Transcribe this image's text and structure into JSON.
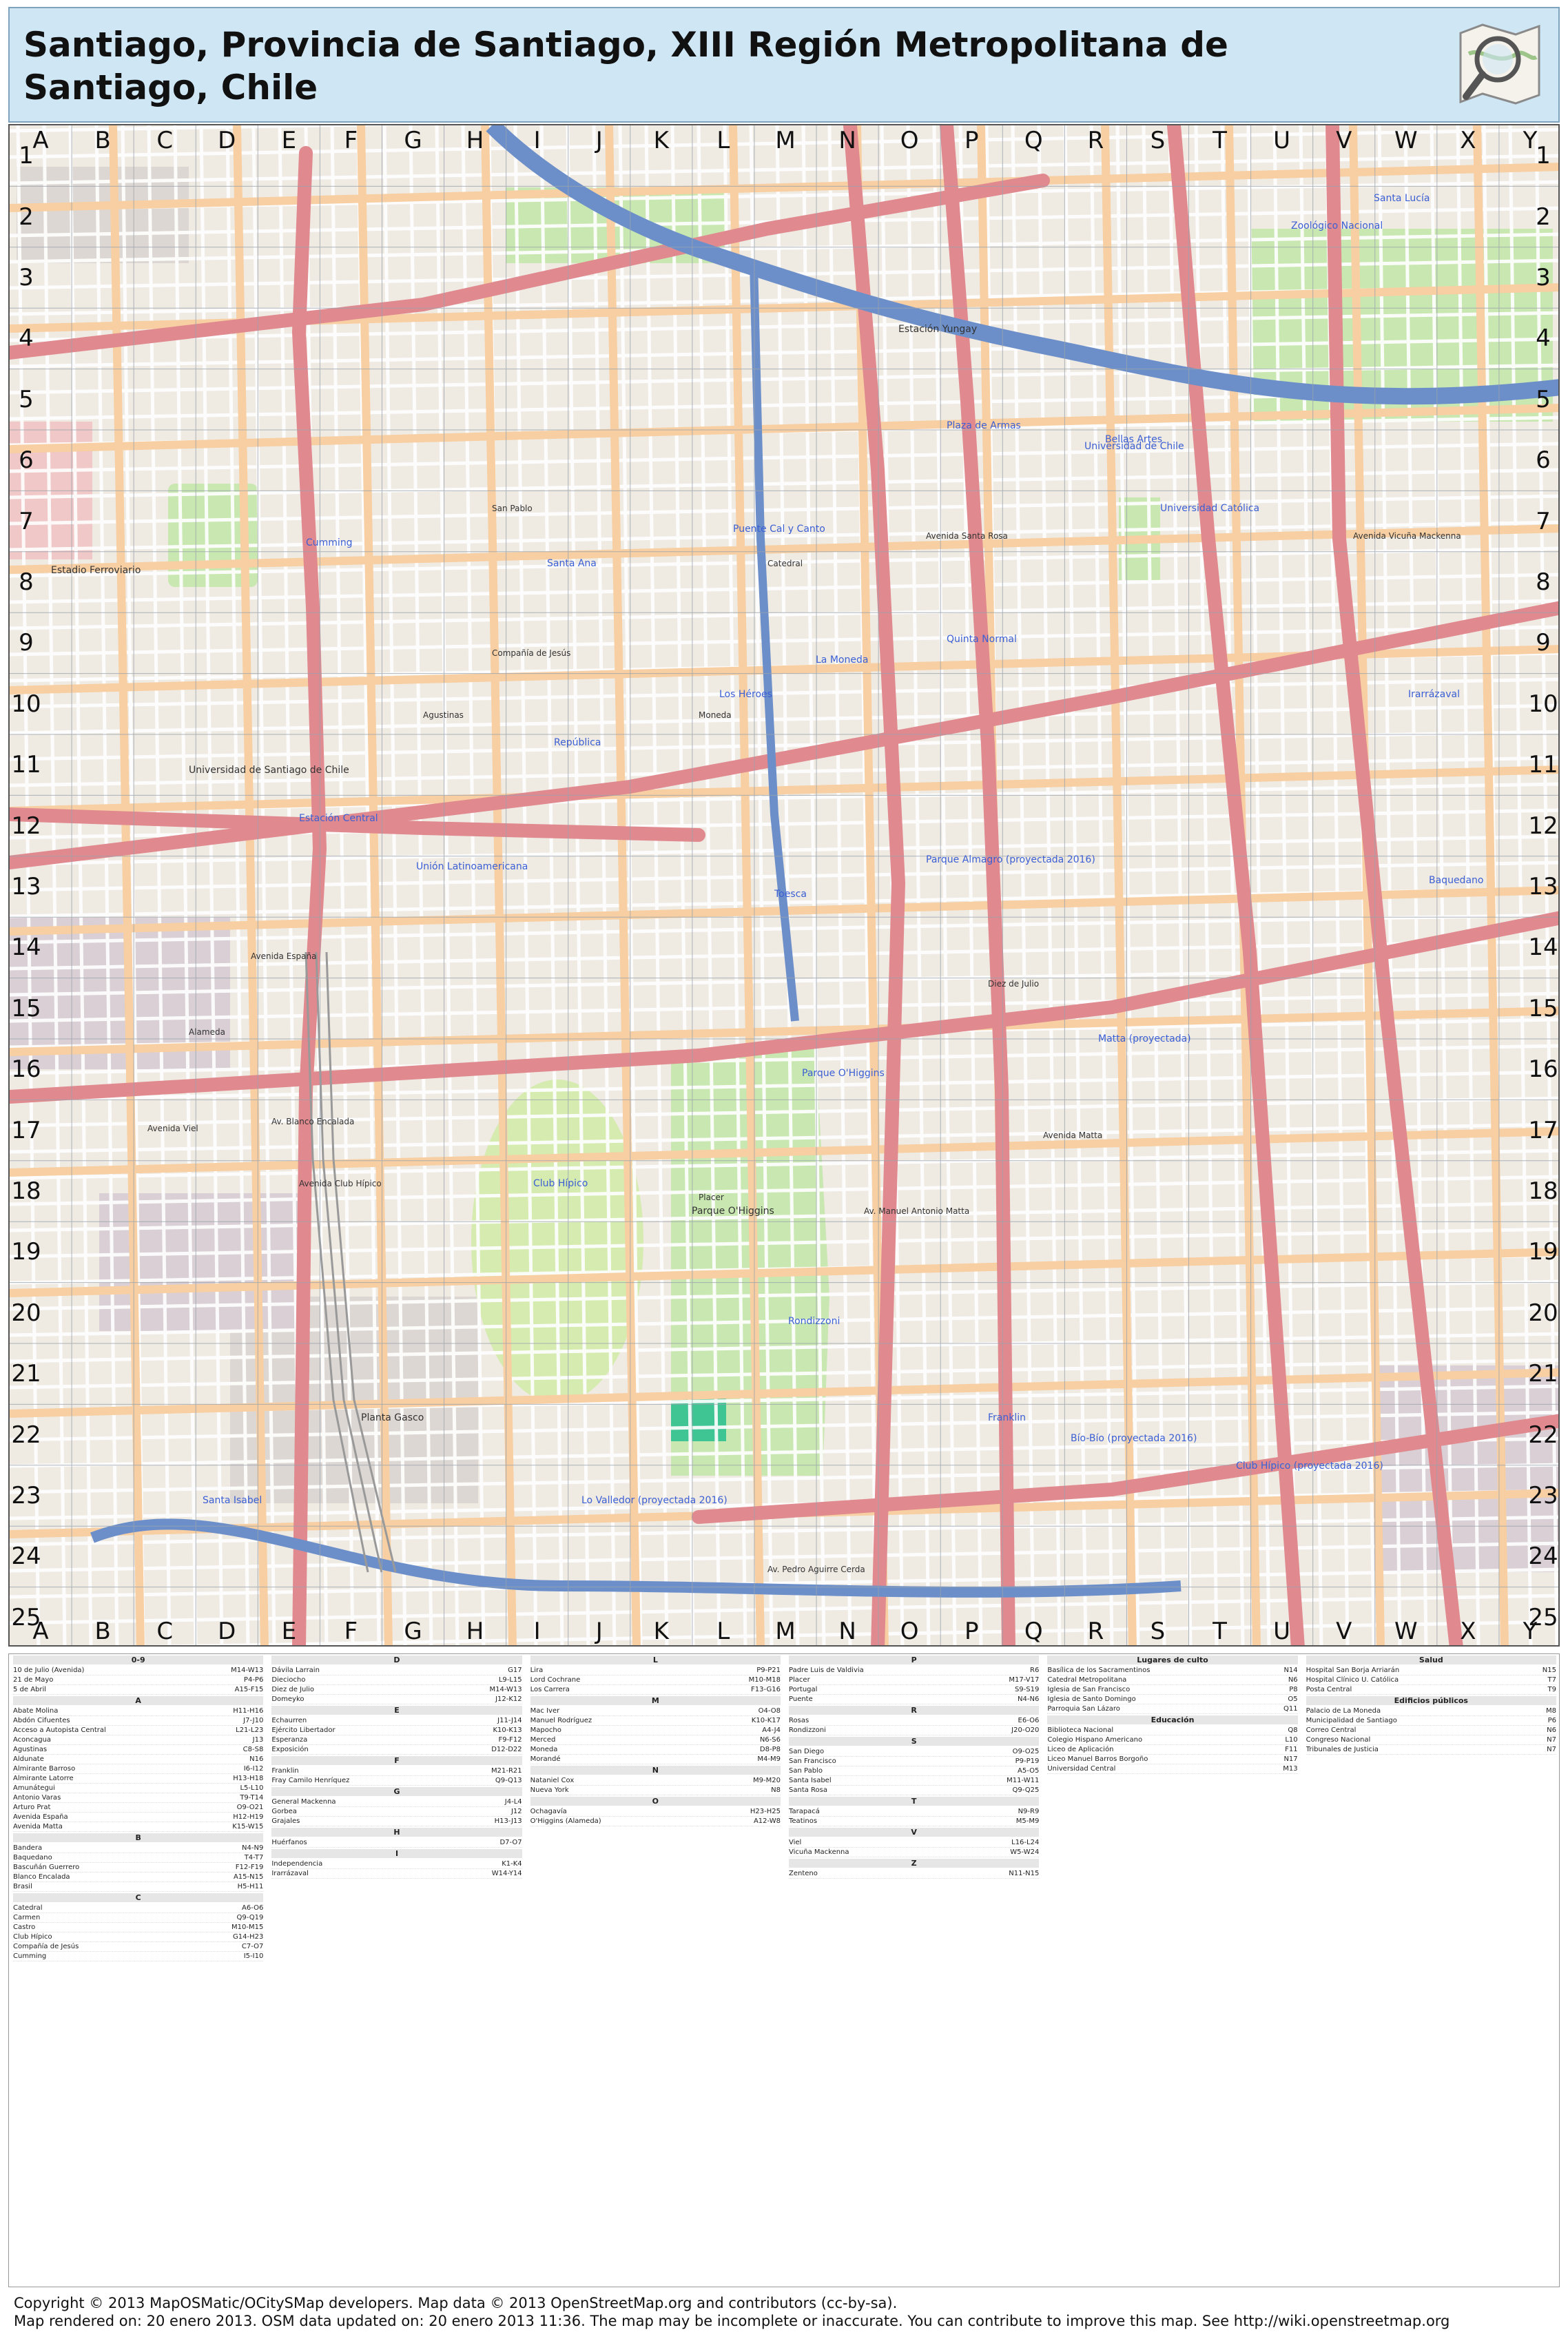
{
  "header": {
    "title": "Santiago, Provincia de Santiago, XIII Región Metropolitana de Santiago, Chile"
  },
  "grid": {
    "columns": [
      "A",
      "B",
      "C",
      "D",
      "E",
      "F",
      "G",
      "H",
      "I",
      "J",
      "K",
      "L",
      "M",
      "N",
      "O",
      "P",
      "Q",
      "R",
      "S",
      "T",
      "U",
      "V",
      "W",
      "X",
      "Y"
    ],
    "rows": [
      "1",
      "2",
      "3",
      "4",
      "5",
      "6",
      "7",
      "8",
      "9",
      "10",
      "11",
      "12",
      "13",
      "14",
      "15",
      "16",
      "17",
      "18",
      "19",
      "20",
      "21",
      "22",
      "23",
      "24",
      "25"
    ]
  },
  "map_labels": {
    "landmarks": [
      {
        "name": "Club Hípico",
        "color": "#3b5fd4"
      },
      {
        "name": "Parque O'Higgins",
        "color": "#333333"
      },
      {
        "name": "Universidad de Santiago de Chile",
        "color": "#333333"
      },
      {
        "name": "Zoológico Nacional",
        "color": "#3b5fd4"
      },
      {
        "name": "Plaza de Armas",
        "color": "#3b5fd4"
      },
      {
        "name": "Bellas Artes",
        "color": "#3b5fd4"
      },
      {
        "name": "Universidad Católica",
        "color": "#3b5fd4"
      },
      {
        "name": "Estación Central",
        "color": "#3b5fd4"
      },
      {
        "name": "Unión Latinoamericana",
        "color": "#3b5fd4"
      },
      {
        "name": "República",
        "color": "#3b5fd4"
      },
      {
        "name": "Los Héroes",
        "color": "#3b5fd4"
      },
      {
        "name": "La Moneda",
        "color": "#3b5fd4"
      },
      {
        "name": "Toesca",
        "color": "#3b5fd4"
      },
      {
        "name": "Parque Almagro (proyectada 2016)",
        "color": "#3b5fd4"
      },
      {
        "name": "Matta (proyectada)",
        "color": "#3b5fd4"
      },
      {
        "name": "Parque O'Higgins",
        "color": "#3b5fd4"
      },
      {
        "name": "Rondizzoni",
        "color": "#3b5fd4"
      },
      {
        "name": "Franklin",
        "color": "#3b5fd4"
      },
      {
        "name": "Bío-Bío (proyectada 2016)",
        "color": "#3b5fd4"
      },
      {
        "name": "Club Hípico (proyectada 2016)",
        "color": "#3b5fd4"
      },
      {
        "name": "Lo Valledor (proyectada 2016)",
        "color": "#3b5fd4"
      },
      {
        "name": "Santa Isabel",
        "color": "#3b5fd4"
      },
      {
        "name": "Irarrázaval",
        "color": "#3b5fd4"
      },
      {
        "name": "Baquedano",
        "color": "#3b5fd4"
      },
      {
        "name": "Santa Lucía",
        "color": "#3b5fd4"
      },
      {
        "name": "Universidad de Chile",
        "color": "#3b5fd4"
      },
      {
        "name": "Quinta Normal",
        "color": "#3b5fd4"
      },
      {
        "name": "Cumming",
        "color": "#3b5fd4"
      },
      {
        "name": "Santa Ana",
        "color": "#3b5fd4"
      },
      {
        "name": "Puente Cal y Canto",
        "color": "#3b5fd4"
      },
      {
        "name": "Estación Yungay",
        "color": "#333333"
      },
      {
        "name": "Estadio Ferroviario",
        "color": "#333333"
      },
      {
        "name": "Planta Gasco",
        "color": "#333333"
      }
    ],
    "streets": [
      "Avenida Santa Rosa",
      "Avenida Matta",
      "San Pablo",
      "Catedral",
      "Compañía de Jesús",
      "Agustinas",
      "Moneda",
      "Alameda",
      "Avenida Viel",
      "Avenida Club Hípico",
      "Diez de Julio",
      "Av. Blanco Encalada",
      "Av. Manuel Antonio Matta",
      "Placer",
      "Avenida España",
      "Avenida Vicuña Mackenna",
      "Av. Pedro Aguirre Cerda"
    ]
  },
  "index": {
    "columns": [
      {
        "sections": [
          {
            "head": "0-9",
            "items": [
              [
                "10 de Julio (Avenida)",
                "M14-W13"
              ],
              [
                "21 de Mayo",
                "P4-P6"
              ],
              [
                "5 de Abril",
                "A15-F15"
              ]
            ]
          },
          {
            "head": "A",
            "items": [
              [
                "Abate Molina",
                "H11-H16"
              ],
              [
                "Abdón Cifuentes",
                "J7-J10"
              ],
              [
                "Acceso a Autopista Central",
                "L21-L23"
              ],
              [
                "Aconcagua",
                "J13"
              ],
              [
                "Agustinas",
                "C8-S8"
              ],
              [
                "Aldunate",
                "N16"
              ],
              [
                "Almirante Barroso",
                "I6-I12"
              ],
              [
                "Almirante Latorre",
                "H13-H18"
              ],
              [
                "Amunátegui",
                "L5-L10"
              ],
              [
                "Antonio Varas",
                "T9-T14"
              ],
              [
                "Arturo Prat",
                "O9-O21"
              ],
              [
                "Avenida España",
                "H12-H19"
              ],
              [
                "Avenida Matta",
                "K15-W15"
              ]
            ]
          },
          {
            "head": "B",
            "items": [
              [
                "Bandera",
                "N4-N9"
              ],
              [
                "Baquedano",
                "T4-T7"
              ],
              [
                "Bascuñán Guerrero",
                "F12-F19"
              ],
              [
                "Blanco Encalada",
                "A15-N15"
              ],
              [
                "Brasil",
                "H5-H11"
              ]
            ]
          },
          {
            "head": "C",
            "items": [
              [
                "Catedral",
                "A6-O6"
              ],
              [
                "Carmen",
                "Q9-Q19"
              ],
              [
                "Castro",
                "M10-M15"
              ],
              [
                "Club Hípico",
                "G14-H23"
              ],
              [
                "Compañía de Jesús",
                "C7-O7"
              ],
              [
                "Cumming",
                "I5-I10"
              ]
            ]
          }
        ]
      },
      {
        "sections": [
          {
            "head": "D",
            "items": [
              [
                "Dávila Larrain",
                "G17"
              ],
              [
                "Dieciocho",
                "L9-L15"
              ],
              [
                "Diez de Julio",
                "M14-W13"
              ],
              [
                "Domeyko",
                "J12-K12"
              ]
            ]
          },
          {
            "head": "E",
            "items": [
              [
                "Echaurren",
                "J11-J14"
              ],
              [
                "Ejército Libertador",
                "K10-K13"
              ],
              [
                "Esperanza",
                "F9-F12"
              ],
              [
                "Exposición",
                "D12-D22"
              ]
            ]
          },
          {
            "head": "F",
            "items": [
              [
                "Franklin",
                "M21-R21"
              ],
              [
                "Fray Camilo Henríquez",
                "Q9-Q13"
              ]
            ]
          },
          {
            "head": "G",
            "items": [
              [
                "General Mackenna",
                "J4-L4"
              ],
              [
                "Gorbea",
                "J12"
              ],
              [
                "Grajales",
                "H13-J13"
              ]
            ]
          },
          {
            "head": "H",
            "items": [
              [
                "Huérfanos",
                "D7-O7"
              ]
            ]
          },
          {
            "head": "I",
            "items": [
              [
                "Independencia",
                "K1-K4"
              ],
              [
                "Irarrázaval",
                "W14-Y14"
              ]
            ]
          }
        ]
      },
      {
        "sections": [
          {
            "head": "L",
            "items": [
              [
                "Lira",
                "P9-P21"
              ],
              [
                "Lord Cochrane",
                "M10-M18"
              ],
              [
                "Los Carrera",
                "F13-G16"
              ]
            ]
          },
          {
            "head": "M",
            "items": [
              [
                "Mac Iver",
                "O4-O8"
              ],
              [
                "Manuel Rodríguez",
                "K10-K17"
              ],
              [
                "Mapocho",
                "A4-J4"
              ],
              [
                "Merced",
                "N6-S6"
              ],
              [
                "Moneda",
                "D8-P8"
              ],
              [
                "Morandé",
                "M4-M9"
              ]
            ]
          },
          {
            "head": "N",
            "items": [
              [
                "Nataniel Cox",
                "M9-M20"
              ],
              [
                "Nueva York",
                "N8"
              ]
            ]
          },
          {
            "head": "O",
            "items": [
              [
                "Ochagavía",
                "H23-H25"
              ],
              [
                "O'Higgins (Alameda)",
                "A12-W8"
              ]
            ]
          }
        ]
      },
      {
        "sections": [
          {
            "head": "P",
            "items": [
              [
                "Padre Luis de Valdivia",
                "R6"
              ],
              [
                "Placer",
                "M17-V17"
              ],
              [
                "Portugal",
                "S9-S19"
              ],
              [
                "Puente",
                "N4-N6"
              ]
            ]
          },
          {
            "head": "R",
            "items": [
              [
                "Rosas",
                "E6-O6"
              ],
              [
                "Rondizzoni",
                "J20-O20"
              ]
            ]
          },
          {
            "head": "S",
            "items": [
              [
                "San Diego",
                "O9-O25"
              ],
              [
                "San Francisco",
                "P9-P19"
              ],
              [
                "San Pablo",
                "A5-O5"
              ],
              [
                "Santa Isabel",
                "M11-W11"
              ],
              [
                "Santa Rosa",
                "Q9-Q25"
              ]
            ]
          },
          {
            "head": "T",
            "items": [
              [
                "Tarapacá",
                "N9-R9"
              ],
              [
                "Teatinos",
                "M5-M9"
              ]
            ]
          },
          {
            "head": "V",
            "items": [
              [
                "Viel",
                "L16-L24"
              ],
              [
                "Vicuña Mackenna",
                "W5-W24"
              ]
            ]
          },
          {
            "head": "Z",
            "items": [
              [
                "Zenteno",
                "N11-N15"
              ]
            ]
          }
        ]
      },
      {
        "sections": [
          {
            "head": "Lugares de culto",
            "items": [
              [
                "Basílica de los Sacramentinos",
                "N14"
              ],
              [
                "Catedral Metropolitana",
                "N6"
              ],
              [
                "Iglesia de San Francisco",
                "P8"
              ],
              [
                "Iglesia de Santo Domingo",
                "O5"
              ],
              [
                "Parroquia San Lázaro",
                "Q11"
              ]
            ]
          },
          {
            "head": "Educación",
            "items": [
              [
                "Biblioteca Nacional",
                "Q8"
              ],
              [
                "Colegio Hispano Americano",
                "L10"
              ],
              [
                "Liceo de Aplicación",
                "F11"
              ],
              [
                "Liceo Manuel Barros Borgoño",
                "N17"
              ],
              [
                "Universidad Central",
                "M13"
              ]
            ]
          }
        ]
      },
      {
        "sections": [
          {
            "head": "Salud",
            "items": [
              [
                "Hospital San Borja Arriarán",
                "N15"
              ],
              [
                "Hospital Clínico U. Católica",
                "T7"
              ],
              [
                "Posta Central",
                "T9"
              ]
            ]
          },
          {
            "head": "Edificios públicos",
            "items": [
              [
                "Palacio de La Moneda",
                "M8"
              ],
              [
                "Municipalidad de Santiago",
                "P6"
              ],
              [
                "Correo Central",
                "N6"
              ],
              [
                "Congreso Nacional",
                "N7"
              ],
              [
                "Tribunales de Justicia",
                "N7"
              ]
            ]
          }
        ]
      }
    ]
  },
  "footer": {
    "line1": "Copyright © 2013 MapOSMatic/OCitySMap developers. Map data © 2013 OpenStreetMap.org and contributors (cc-by-sa).",
    "line2": "Map rendered on: 20 enero 2013. OSM data updated on: 20 enero 2013 11:36. The map may be incomplete or inaccurate. You can contribute to improve this map. See http://wiki.openstreetmap.org"
  },
  "colors": {
    "header_bg": "#cfe6f5",
    "map_bg": "#efeae2",
    "primary_road": "#e0898f",
    "secondary_road": "#f7cfa2",
    "tertiary_road": "#fbf7a9",
    "park": "#c9e7b0",
    "water": "#6c8fc9",
    "railway": "#999999",
    "station_label": "#3b5fd4"
  }
}
